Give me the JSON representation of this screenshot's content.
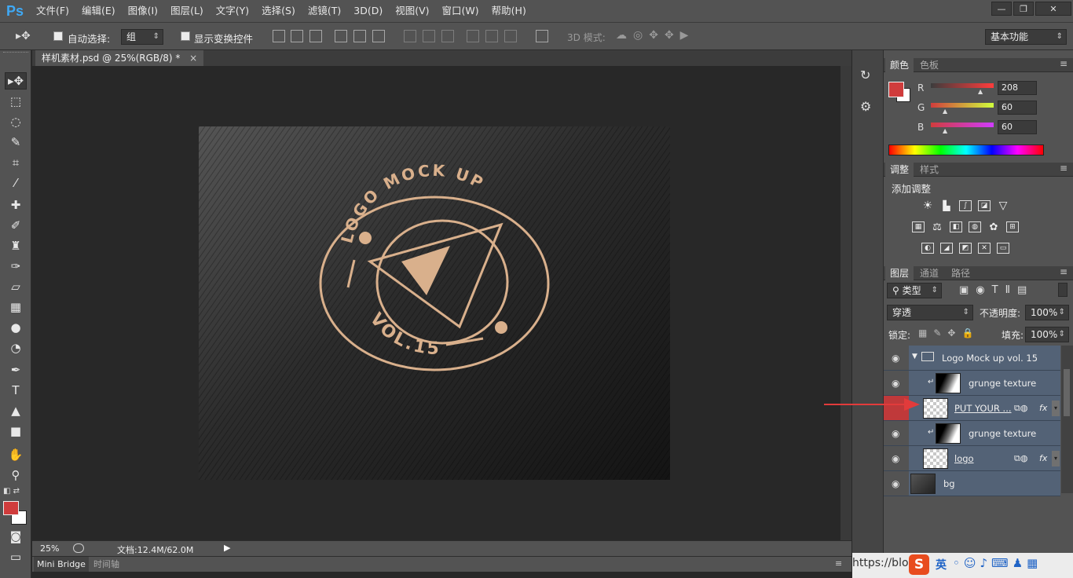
{
  "app": {
    "logo": "Ps"
  },
  "menu": [
    "文件(F)",
    "编辑(E)",
    "图像(I)",
    "图层(L)",
    "文字(Y)",
    "选择(S)",
    "滤镜(T)",
    "3D(D)",
    "视图(V)",
    "窗口(W)",
    "帮助(H)"
  ],
  "window_controls": {
    "minimize": "—",
    "restore": "❐",
    "close": "✕"
  },
  "options": {
    "auto_select_label": "自动选择:",
    "auto_select_value": "组",
    "show_transform_label": "显示变换控件",
    "mode_3d_label": "3D 模式:",
    "workspace": "基本功能"
  },
  "document": {
    "tab_title": "样机素材.psd @ 25%(RGB/8) *",
    "close": "×"
  },
  "artwork": {
    "top_text": "LOGO MOCK UP",
    "bottom_text": "VOL.15",
    "colors": {
      "gold": "#d9b08c",
      "fabric": "#2b2b2b"
    }
  },
  "status": {
    "zoom": "25%",
    "doc_info": "文档:12.4M/62.0M"
  },
  "bottom_tabs": [
    "Mini Bridge",
    "时间轴"
  ],
  "color_panel": {
    "tabs": [
      "颜色",
      "色板"
    ],
    "channels": [
      {
        "label": "R",
        "value": "208"
      },
      {
        "label": "G",
        "value": "60"
      },
      {
        "label": "B",
        "value": "60"
      }
    ],
    "fg_color": "#d03c3c",
    "bg_color": "#ffffff"
  },
  "adjust_panel": {
    "tabs": [
      "调整",
      "样式"
    ],
    "title": "添加调整"
  },
  "layers_panel": {
    "tabs": [
      "图层",
      "通道",
      "路径"
    ],
    "filter_type": "类型",
    "blend_mode": "穿透",
    "opacity_label": "不透明度:",
    "opacity_value": "100%",
    "lock_label": "锁定:",
    "fill_label": "填充:",
    "fill_value": "100%",
    "layers": [
      {
        "name": "Logo Mock up vol. 15",
        "kind": "group"
      },
      {
        "name": "grunge texture",
        "kind": "clip"
      },
      {
        "name": "PUT YOUR ...",
        "kind": "smart",
        "fx": "fx"
      },
      {
        "name": "grunge texture",
        "kind": "clip"
      },
      {
        "name": "logo",
        "kind": "smart",
        "fx": "fx"
      },
      {
        "name": "bg",
        "kind": "bg"
      }
    ]
  },
  "taskbar": {
    "url_fragment": "https://blog",
    "ime_label": "英"
  }
}
